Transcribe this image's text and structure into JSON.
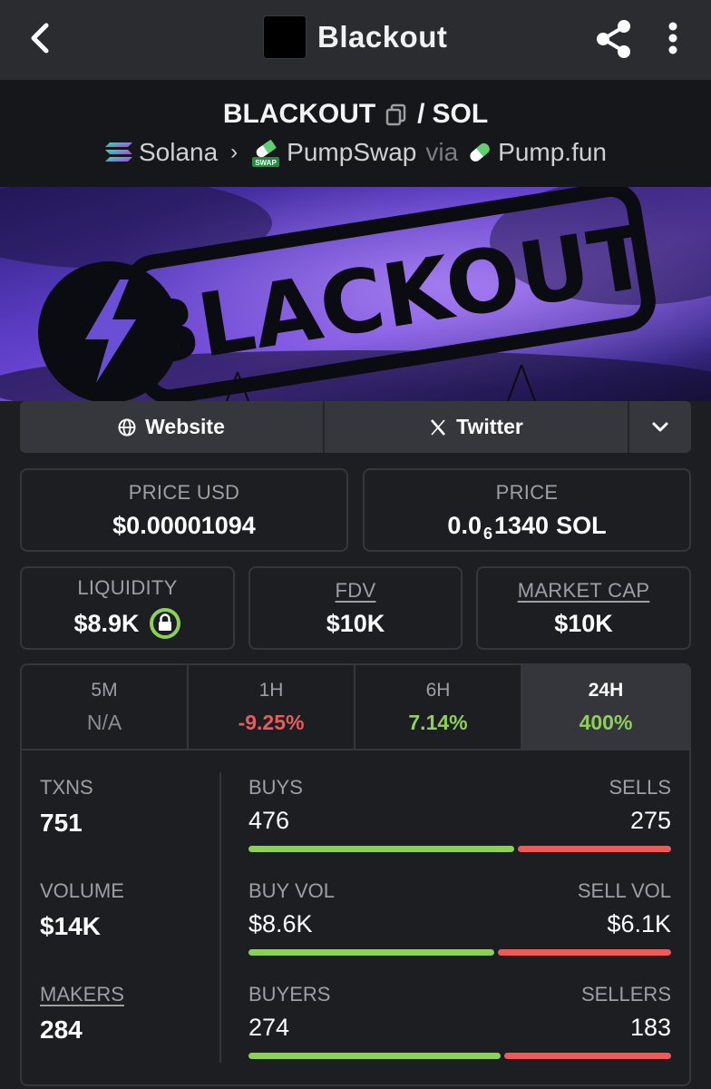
{
  "app_bar": {
    "title": "Blackout",
    "icons": {
      "back": "chevron-left-icon",
      "share": "share-icon",
      "more": "more-vertical-icon"
    }
  },
  "pair": {
    "base": "BLACKOUT",
    "separator": "/",
    "quote": "SOL",
    "chain": "Solana",
    "dex": "PumpSwap",
    "dex_badge": "SWAP",
    "via": "via",
    "launchpad": "Pump.fun"
  },
  "banner": {
    "text": "BLACKOUT"
  },
  "links": {
    "website": "Website",
    "twitter": "Twitter"
  },
  "price_usd": {
    "label": "PRICE USD",
    "value": "$0.00001094"
  },
  "price": {
    "label": "PRICE",
    "prefix": "0.0",
    "zeros": "6",
    "digits": "1340",
    "unit": "SOL"
  },
  "liquidity": {
    "label": "LIQUIDITY",
    "value": "$8.9K"
  },
  "fdv": {
    "label": "FDV",
    "value": "$10K"
  },
  "market_cap": {
    "label": "MARKET CAP",
    "value": "$10K"
  },
  "timeframes": [
    {
      "label": "5M",
      "value": "N/A"
    },
    {
      "label": "1H",
      "value": "-9.25%"
    },
    {
      "label": "6H",
      "value": "7.14%"
    },
    {
      "label": "24H",
      "value": "400%"
    }
  ],
  "stats": {
    "txns": {
      "label": "TXNS",
      "value": "751"
    },
    "volume": {
      "label": "VOLUME",
      "value": "$14K"
    },
    "makers": {
      "label": "MAKERS",
      "value": "284"
    },
    "buys": {
      "label": "BUYS",
      "value": "476",
      "fraction": 0.634
    },
    "sells": {
      "label": "SELLS",
      "value": "275"
    },
    "buy_vol": {
      "label": "BUY VOL",
      "value": "$8.6K",
      "fraction": 0.585
    },
    "sell_vol": {
      "label": "SELL VOL",
      "value": "$6.1K"
    },
    "buyers": {
      "label": "BUYERS",
      "value": "274",
      "fraction": 0.6
    },
    "sellers": {
      "label": "SELLERS",
      "value": "183"
    }
  },
  "colors": {
    "positive": "#8ecf5c",
    "negative": "#ea5c5c",
    "background": "#1d1e22",
    "card_border": "#35363b"
  }
}
